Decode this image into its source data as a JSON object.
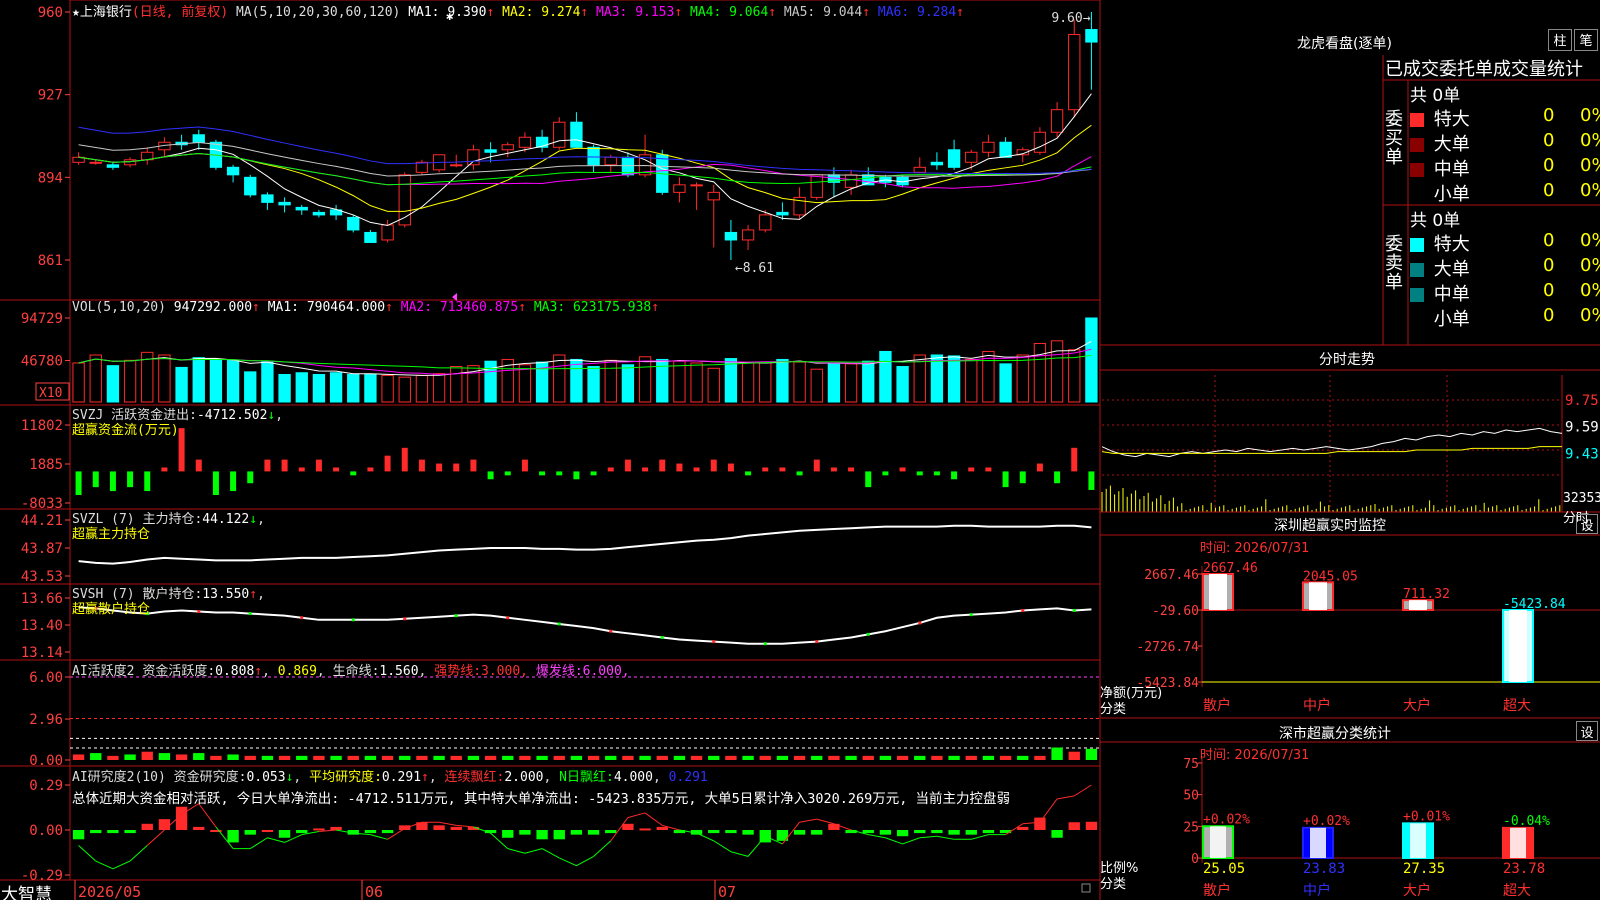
{
  "brand": "大智慧",
  "colors": {
    "up": "#ff2a2a",
    "down": "#00ffff",
    "grid": "#b01010",
    "axis": "#ff4040",
    "ma1": "#ffffff",
    "ma2": "#ffff00",
    "ma3": "#ff00ff",
    "ma4": "#00ff00",
    "ma5": "#c8c8c8",
    "ma6": "#3030ff",
    "green": "#00ff00",
    "yellow": "#ffff00",
    "magenta": "#ff40ff",
    "dark_red": "#880000",
    "dark_teal": "#008080"
  },
  "main": {
    "title_prefix": "★",
    "stock": "上海银行",
    "period": "(日线, 前复权)",
    "ma_label": "MA(5,10,20,30,60,120)",
    "ma_values": [
      {
        "label": "MA1:",
        "value": "9.390",
        "arrow": "↑"
      },
      {
        "label": "MA2:",
        "value": "9.274",
        "arrow": "↑"
      },
      {
        "label": "MA3:",
        "value": "9.153",
        "arrow": "↑"
      },
      {
        "label": "MA4:",
        "value": "9.064",
        "arrow": "↑"
      },
      {
        "label": "MA5:",
        "value": "9.044",
        "arrow": "↑"
      },
      {
        "label": "MA6:",
        "value": "9.284",
        "arrow": "↑"
      }
    ],
    "high_note": "9.60",
    "low_note": "8.61",
    "yticks": [
      "960",
      "927",
      "894",
      "861"
    ]
  },
  "vol": {
    "label": "VOL(5,10,20)",
    "value": "947292.000",
    "arrow": "↑",
    "ma": [
      {
        "label": "MA1:",
        "value": "790464.000",
        "arrow": "↑"
      },
      {
        "label": "MA2:",
        "value": "713460.875",
        "arrow": "↑"
      },
      {
        "label": "MA3:",
        "value": "623175.938",
        "arrow": "↑"
      }
    ],
    "yticks": [
      "94729",
      "46780"
    ],
    "unit": "X10"
  },
  "svzj": {
    "label": "SVZJ",
    "desc": "活跃资金进出:",
    "value": "-4712.502",
    "arrow": "↓",
    "sub": "超赢资金流(万元)",
    "yticks": [
      "11802",
      "1885",
      "-8033"
    ]
  },
  "svzl": {
    "label": "SVZL (7)",
    "desc": "主力持仓:",
    "value": "44.122",
    "arrow": "↓",
    "sub": "超赢主力持仓",
    "yticks": [
      "44.21",
      "43.87",
      "43.53"
    ]
  },
  "svsh": {
    "label": "SVSH (7)",
    "desc": "散户持仓:",
    "value": "13.550",
    "arrow": "↑",
    "sub": "超赢散户持仓",
    "yticks": [
      "13.66",
      "13.40",
      "13.14"
    ]
  },
  "ai1": {
    "label": "AI活跃度2",
    "desc": "资金活跃度:",
    "value": "0.808",
    "arrow": "↑",
    "v2": "0.869",
    "life_label": "生命线:",
    "life": "1.560",
    "strong_label": "强势线:",
    "strong": "3.000",
    "burst_label": "爆发线:",
    "burst": "6.000",
    "yticks": [
      "6.00",
      "2.96",
      "0.00"
    ]
  },
  "ai2": {
    "label": "AI研究度2(10)",
    "desc": "资金研究度:",
    "value": "0.053",
    "arrow": "↓",
    "avg_label": "平均研究度:",
    "avg": "0.291",
    "avg_arrow": "↑",
    "cont_label": "连续飘红:",
    "cont": "2.000",
    "n_label": "N日飘红:",
    "n": "4.000",
    "last": "0.291",
    "summary": "总体近期大资金相对活跃, 今日大单净流出: -4712.511万元, 其中特大单净流出: -5423.835万元, 大单5日累计净入3020.269万元, 当前主力控盘弱",
    "yticks": [
      "0.29",
      "0.00",
      "-0.29"
    ]
  },
  "xaxis": {
    "labels": [
      "2026/05",
      "06",
      "07"
    ]
  },
  "right": {
    "dragon_title": "龙虎看盘(逐单)",
    "btn_bar": "柱",
    "btn_pen": "笔",
    "tabs": [
      "已成交",
      "委托单",
      "成交量统计"
    ],
    "buy": {
      "side": "委买单",
      "total": "共 0单",
      "rows": [
        {
          "name": "特大",
          "count": "0",
          "pct": "0%"
        },
        {
          "name": "大单",
          "count": "0",
          "pct": "0%"
        },
        {
          "name": "中单",
          "count": "0",
          "pct": "0%"
        },
        {
          "name": "小单",
          "count": "0",
          "pct": "0%"
        }
      ]
    },
    "sell": {
      "side": "委卖单",
      "total": "共 0单",
      "rows": [
        {
          "name": "特大",
          "count": "0",
          "pct": "0%"
        },
        {
          "name": "大单",
          "count": "0",
          "pct": "0%"
        },
        {
          "name": "中单",
          "count": "0",
          "pct": "0%"
        },
        {
          "name": "小单",
          "count": "0",
          "pct": "0%"
        }
      ]
    },
    "intraday": {
      "title": "分时走势",
      "yticks": [
        "9.75",
        "9.59",
        "9.43"
      ],
      "vol_tick": "32353",
      "vol_unit": "分时"
    },
    "monitor": {
      "title": "深圳超赢实时监控",
      "btn": "设",
      "time": "时间: 2026/07/31",
      "ylabel": "净额(万元)",
      "xlabel": "分类",
      "yticks": [
        "2667.46",
        "-29.60",
        "-2726.74",
        "-5423.84"
      ],
      "categories": [
        "散户",
        "中户",
        "大户",
        "超大"
      ],
      "values": [
        "2667.46",
        "2045.05",
        "711.32",
        "-5423.84"
      ]
    },
    "classify": {
      "title": "深市超赢分类统计",
      "btn": "设",
      "time": "时间: 2026/07/31",
      "ylabel": "比例%",
      "xlabel": "分类",
      "yticks": [
        "75",
        "50",
        "25",
        "0"
      ],
      "categories": [
        "散户",
        "中户",
        "大户",
        "超大"
      ],
      "changes": [
        "+0.02%",
        "+0.02%",
        "+0.01%",
        "-0.04%"
      ],
      "values": [
        "25.05",
        "23.83",
        "27.35",
        "23.78"
      ]
    }
  },
  "chart_data": {
    "type": "candlestick",
    "count": 60,
    "ohlc": [
      [
        9.0,
        9.04,
        8.99,
        9.02
      ],
      [
        9.0,
        9.01,
        8.99,
        9.0
      ],
      [
        8.99,
        9.0,
        8.97,
        8.98
      ],
      [
        8.99,
        9.02,
        8.98,
        9.01
      ],
      [
        9.01,
        9.06,
        8.99,
        9.04
      ],
      [
        9.05,
        9.1,
        9.02,
        9.08
      ],
      [
        9.08,
        9.11,
        9.05,
        9.07
      ],
      [
        9.11,
        9.13,
        9.05,
        9.08
      ],
      [
        9.08,
        9.09,
        8.97,
        8.98
      ],
      [
        8.98,
        8.99,
        8.92,
        8.95
      ],
      [
        8.94,
        8.95,
        8.86,
        8.87
      ],
      [
        8.87,
        8.88,
        8.81,
        8.84
      ],
      [
        8.84,
        8.86,
        8.8,
        8.83
      ],
      [
        8.82,
        8.83,
        8.79,
        8.81
      ],
      [
        8.8,
        8.81,
        8.78,
        8.79
      ],
      [
        8.81,
        8.83,
        8.77,
        8.79
      ],
      [
        8.78,
        8.79,
        8.72,
        8.73
      ],
      [
        8.72,
        8.73,
        8.68,
        8.68
      ],
      [
        8.69,
        8.77,
        8.68,
        8.75
      ],
      [
        8.75,
        8.96,
        8.74,
        8.95
      ],
      [
        8.96,
        9.01,
        8.95,
        9.0
      ],
      [
        8.97,
        9.03,
        8.96,
        9.03
      ],
      [
        8.99,
        9.03,
        8.98,
        8.99
      ],
      [
        8.99,
        9.07,
        8.97,
        9.05
      ],
      [
        9.05,
        9.08,
        9.0,
        9.04
      ],
      [
        9.05,
        9.08,
        9.02,
        9.07
      ],
      [
        9.06,
        9.12,
        9.04,
        9.1
      ],
      [
        9.1,
        9.13,
        9.04,
        9.06
      ],
      [
        9.06,
        9.18,
        9.05,
        9.16
      ],
      [
        9.16,
        9.2,
        9.06,
        9.06
      ],
      [
        9.06,
        9.07,
        8.96,
        8.99
      ],
      [
        8.99,
        9.03,
        8.96,
        9.02
      ],
      [
        9.02,
        9.04,
        8.94,
        8.95
      ],
      [
        8.95,
        9.11,
        8.94,
        9.03
      ],
      [
        9.03,
        9.05,
        8.87,
        8.88
      ],
      [
        8.88,
        8.94,
        8.84,
        8.91
      ],
      [
        8.91,
        8.92,
        8.81,
        8.91
      ],
      [
        8.85,
        8.91,
        8.66,
        8.88
      ],
      [
        8.72,
        8.77,
        8.61,
        8.69
      ],
      [
        8.69,
        8.75,
        8.65,
        8.73
      ],
      [
        8.73,
        8.81,
        8.72,
        8.79
      ],
      [
        8.8,
        8.84,
        8.77,
        8.79
      ],
      [
        8.79,
        8.9,
        8.77,
        8.86
      ],
      [
        8.86,
        8.95,
        8.85,
        8.95
      ],
      [
        8.95,
        8.98,
        8.86,
        8.92
      ],
      [
        8.9,
        8.97,
        8.87,
        8.95
      ],
      [
        8.95,
        8.98,
        8.91,
        8.91
      ],
      [
        8.94,
        8.95,
        8.9,
        8.92
      ],
      [
        8.94,
        8.95,
        8.9,
        8.91
      ],
      [
        8.96,
        9.02,
        8.96,
        8.98
      ],
      [
        9.0,
        9.04,
        8.97,
        8.99
      ],
      [
        9.05,
        9.09,
        8.97,
        8.98
      ],
      [
        9.0,
        9.05,
        8.97,
        9.04
      ],
      [
        9.04,
        9.11,
        9.02,
        9.08
      ],
      [
        9.08,
        9.1,
        9.02,
        9.02
      ],
      [
        9.03,
        9.06,
        9.0,
        9.05
      ],
      [
        9.04,
        9.14,
        9.03,
        9.12
      ],
      [
        9.12,
        9.24,
        9.1,
        9.21
      ],
      [
        9.21,
        9.57,
        9.18,
        9.51
      ],
      [
        9.53,
        9.6,
        9.29,
        9.48
      ]
    ],
    "volume": [
      44000,
      53000,
      41000,
      47000,
      56000,
      53000,
      39000,
      50000,
      48000,
      47000,
      34000,
      46000,
      31000,
      33000,
      31000,
      33000,
      31000,
      31000,
      30000,
      28000,
      30000,
      32000,
      40000,
      41000,
      46000,
      48000,
      42000,
      45000,
      53000,
      48000,
      40000,
      47000,
      42000,
      51000,
      48000,
      46000,
      44000,
      38000,
      49000,
      44000,
      45000,
      48000,
      45000,
      37000,
      44000,
      43000,
      46000,
      57000,
      40000,
      53000,
      53000,
      52000,
      48000,
      57000,
      43000,
      53000,
      66000,
      69000,
      59000,
      94729
    ],
    "flow": [
      -6000,
      -4000,
      -5000,
      -4000,
      -5000,
      1000,
      11000,
      3000,
      -6000,
      -5000,
      -3000,
      3000,
      3000,
      1000,
      3000,
      1000,
      -1000,
      1000,
      4000,
      6000,
      3000,
      2000,
      2000,
      3000,
      -2000,
      -1000,
      3000,
      -1000,
      -1000,
      -2000,
      -1000,
      1000,
      3000,
      1000,
      3000,
      2000,
      1000,
      3000,
      2000,
      -1000,
      1000,
      1000,
      -1000,
      3000,
      1000,
      1000,
      -4000,
      -1000,
      1000,
      -1000,
      -1000,
      -2000,
      1000,
      1000,
      -4000,
      -3000,
      2000,
      -3000,
      6000,
      -4712
    ],
    "svzl": [
      43.71,
      43.69,
      43.68,
      43.7,
      43.73,
      43.75,
      43.74,
      43.73,
      43.72,
      43.72,
      43.72,
      43.73,
      43.74,
      43.75,
      43.75,
      43.75,
      43.76,
      43.77,
      43.78,
      43.8,
      43.82,
      43.84,
      43.85,
      43.86,
      43.87,
      43.87,
      43.87,
      43.86,
      43.86,
      43.85,
      43.85,
      43.86,
      43.88,
      43.9,
      43.92,
      43.94,
      43.96,
      43.97,
      43.99,
      44.02,
      44.04,
      44.06,
      44.08,
      44.09,
      44.1,
      44.11,
      44.12,
      44.13,
      44.13,
      44.13,
      44.13,
      44.14,
      44.14,
      44.13,
      44.13,
      44.13,
      44.13,
      44.14,
      44.14,
      44.12
    ],
    "svsh": [
      13.57,
      13.56,
      13.54,
      13.52,
      13.51,
      13.53,
      13.54,
      13.53,
      13.52,
      13.52,
      13.51,
      13.5,
      13.49,
      13.47,
      13.45,
      13.45,
      13.45,
      13.45,
      13.45,
      13.46,
      13.47,
      13.48,
      13.49,
      13.5,
      13.49,
      13.47,
      13.45,
      13.43,
      13.41,
      13.39,
      13.37,
      13.34,
      13.32,
      13.3,
      13.28,
      13.26,
      13.25,
      13.24,
      13.23,
      13.22,
      13.22,
      13.22,
      13.23,
      13.24,
      13.26,
      13.28,
      13.31,
      13.34,
      13.38,
      13.42,
      13.47,
      13.49,
      13.5,
      13.51,
      13.52,
      13.54,
      13.55,
      13.56,
      13.54,
      13.55
    ],
    "ai1": [
      0.4,
      0.5,
      0.3,
      0.4,
      0.6,
      0.5,
      0.4,
      0.5,
      0.3,
      0.4,
      0.3,
      0.3,
      0.3,
      0.3,
      0.3,
      0.3,
      0.3,
      0.3,
      0.3,
      0.3,
      0.3,
      0.3,
      0.3,
      0.3,
      0.3,
      0.3,
      0.3,
      0.3,
      0.3,
      0.3,
      0.3,
      0.3,
      0.3,
      0.3,
      0.3,
      0.3,
      0.3,
      0.3,
      0.3,
      0.3,
      0.3,
      0.3,
      0.3,
      0.3,
      0.3,
      0.3,
      0.3,
      0.3,
      0.3,
      0.3,
      0.3,
      0.3,
      0.3,
      0.3,
      0.3,
      0.3,
      0.3,
      0.9,
      0.6,
      0.808
    ],
    "ai2_bars": [
      -0.06,
      -0.02,
      -0.02,
      -0.02,
      0.04,
      0.07,
      0.15,
      0.02,
      0.0,
      -0.08,
      -0.03,
      0.0,
      -0.05,
      -0.02,
      0.01,
      0.02,
      -0.03,
      -0.02,
      -0.02,
      0.03,
      0.05,
      0.03,
      0.02,
      0.02,
      -0.02,
      -0.05,
      -0.03,
      -0.06,
      -0.06,
      -0.03,
      -0.03,
      -0.02,
      0.04,
      0.01,
      0.02,
      -0.02,
      -0.03,
      -0.02,
      -0.02,
      -0.03,
      -0.08,
      -0.07,
      -0.03,
      -0.03,
      0.04,
      -0.02,
      -0.02,
      -0.03,
      -0.04,
      -0.02,
      -0.02,
      -0.03,
      -0.03,
      -0.02,
      -0.02,
      0.02,
      0.08,
      -0.05,
      0.05,
      0.053
    ],
    "ai2_line": [
      -0.1,
      -0.2,
      -0.25,
      -0.2,
      -0.1,
      0.0,
      0.1,
      0.17,
      0.02,
      -0.12,
      -0.12,
      -0.05,
      -0.08,
      -0.03,
      -0.01,
      0.0,
      -0.02,
      -0.03,
      -0.06,
      0.01,
      0.05,
      0.05,
      0.03,
      0.02,
      -0.02,
      -0.12,
      -0.15,
      -0.12,
      -0.18,
      -0.23,
      -0.17,
      -0.07,
      0.08,
      0.11,
      0.03,
      0.0,
      -0.02,
      -0.07,
      -0.14,
      -0.17,
      -0.04,
      -0.09,
      0.05,
      0.07,
      0.04,
      0.0,
      -0.03,
      -0.05,
      -0.09,
      -0.05,
      -0.04,
      -0.06,
      -0.06,
      -0.03,
      -0.03,
      0.04,
      0.05,
      0.2,
      0.22,
      0.29
    ],
    "intraday_price": [
      9.47,
      9.44,
      9.42,
      9.41,
      9.43,
      9.42,
      9.41,
      9.43,
      9.44,
      9.43,
      9.44,
      9.45,
      9.44,
      9.46,
      9.45,
      9.44,
      9.45,
      9.46,
      9.45,
      9.46,
      9.47,
      9.46,
      9.45,
      9.46,
      9.47,
      9.49,
      9.5,
      9.52,
      9.51,
      9.53,
      9.54,
      9.53,
      9.55,
      9.54,
      9.56,
      9.55,
      9.57,
      9.56,
      9.57,
      9.58,
      9.56,
      9.55
    ],
    "intraday_avg": [
      9.44,
      9.43,
      9.43,
      9.43,
      9.43,
      9.43,
      9.43,
      9.43,
      9.43,
      9.43,
      9.43,
      9.43,
      9.43,
      9.43,
      9.43,
      9.43,
      9.43,
      9.43,
      9.43,
      9.43,
      9.43,
      9.44,
      9.44,
      9.44,
      9.44,
      9.44,
      9.44,
      9.44,
      9.45,
      9.45,
      9.45,
      9.45,
      9.45,
      9.46,
      9.46,
      9.46,
      9.46,
      9.46,
      9.46,
      9.47,
      9.47,
      9.47
    ],
    "classify_values": [
      25.05,
      23.83,
      27.35,
      23.78
    ],
    "monitor_values": [
      2667.46,
      2045.05,
      711.32,
      -5423.84
    ]
  }
}
